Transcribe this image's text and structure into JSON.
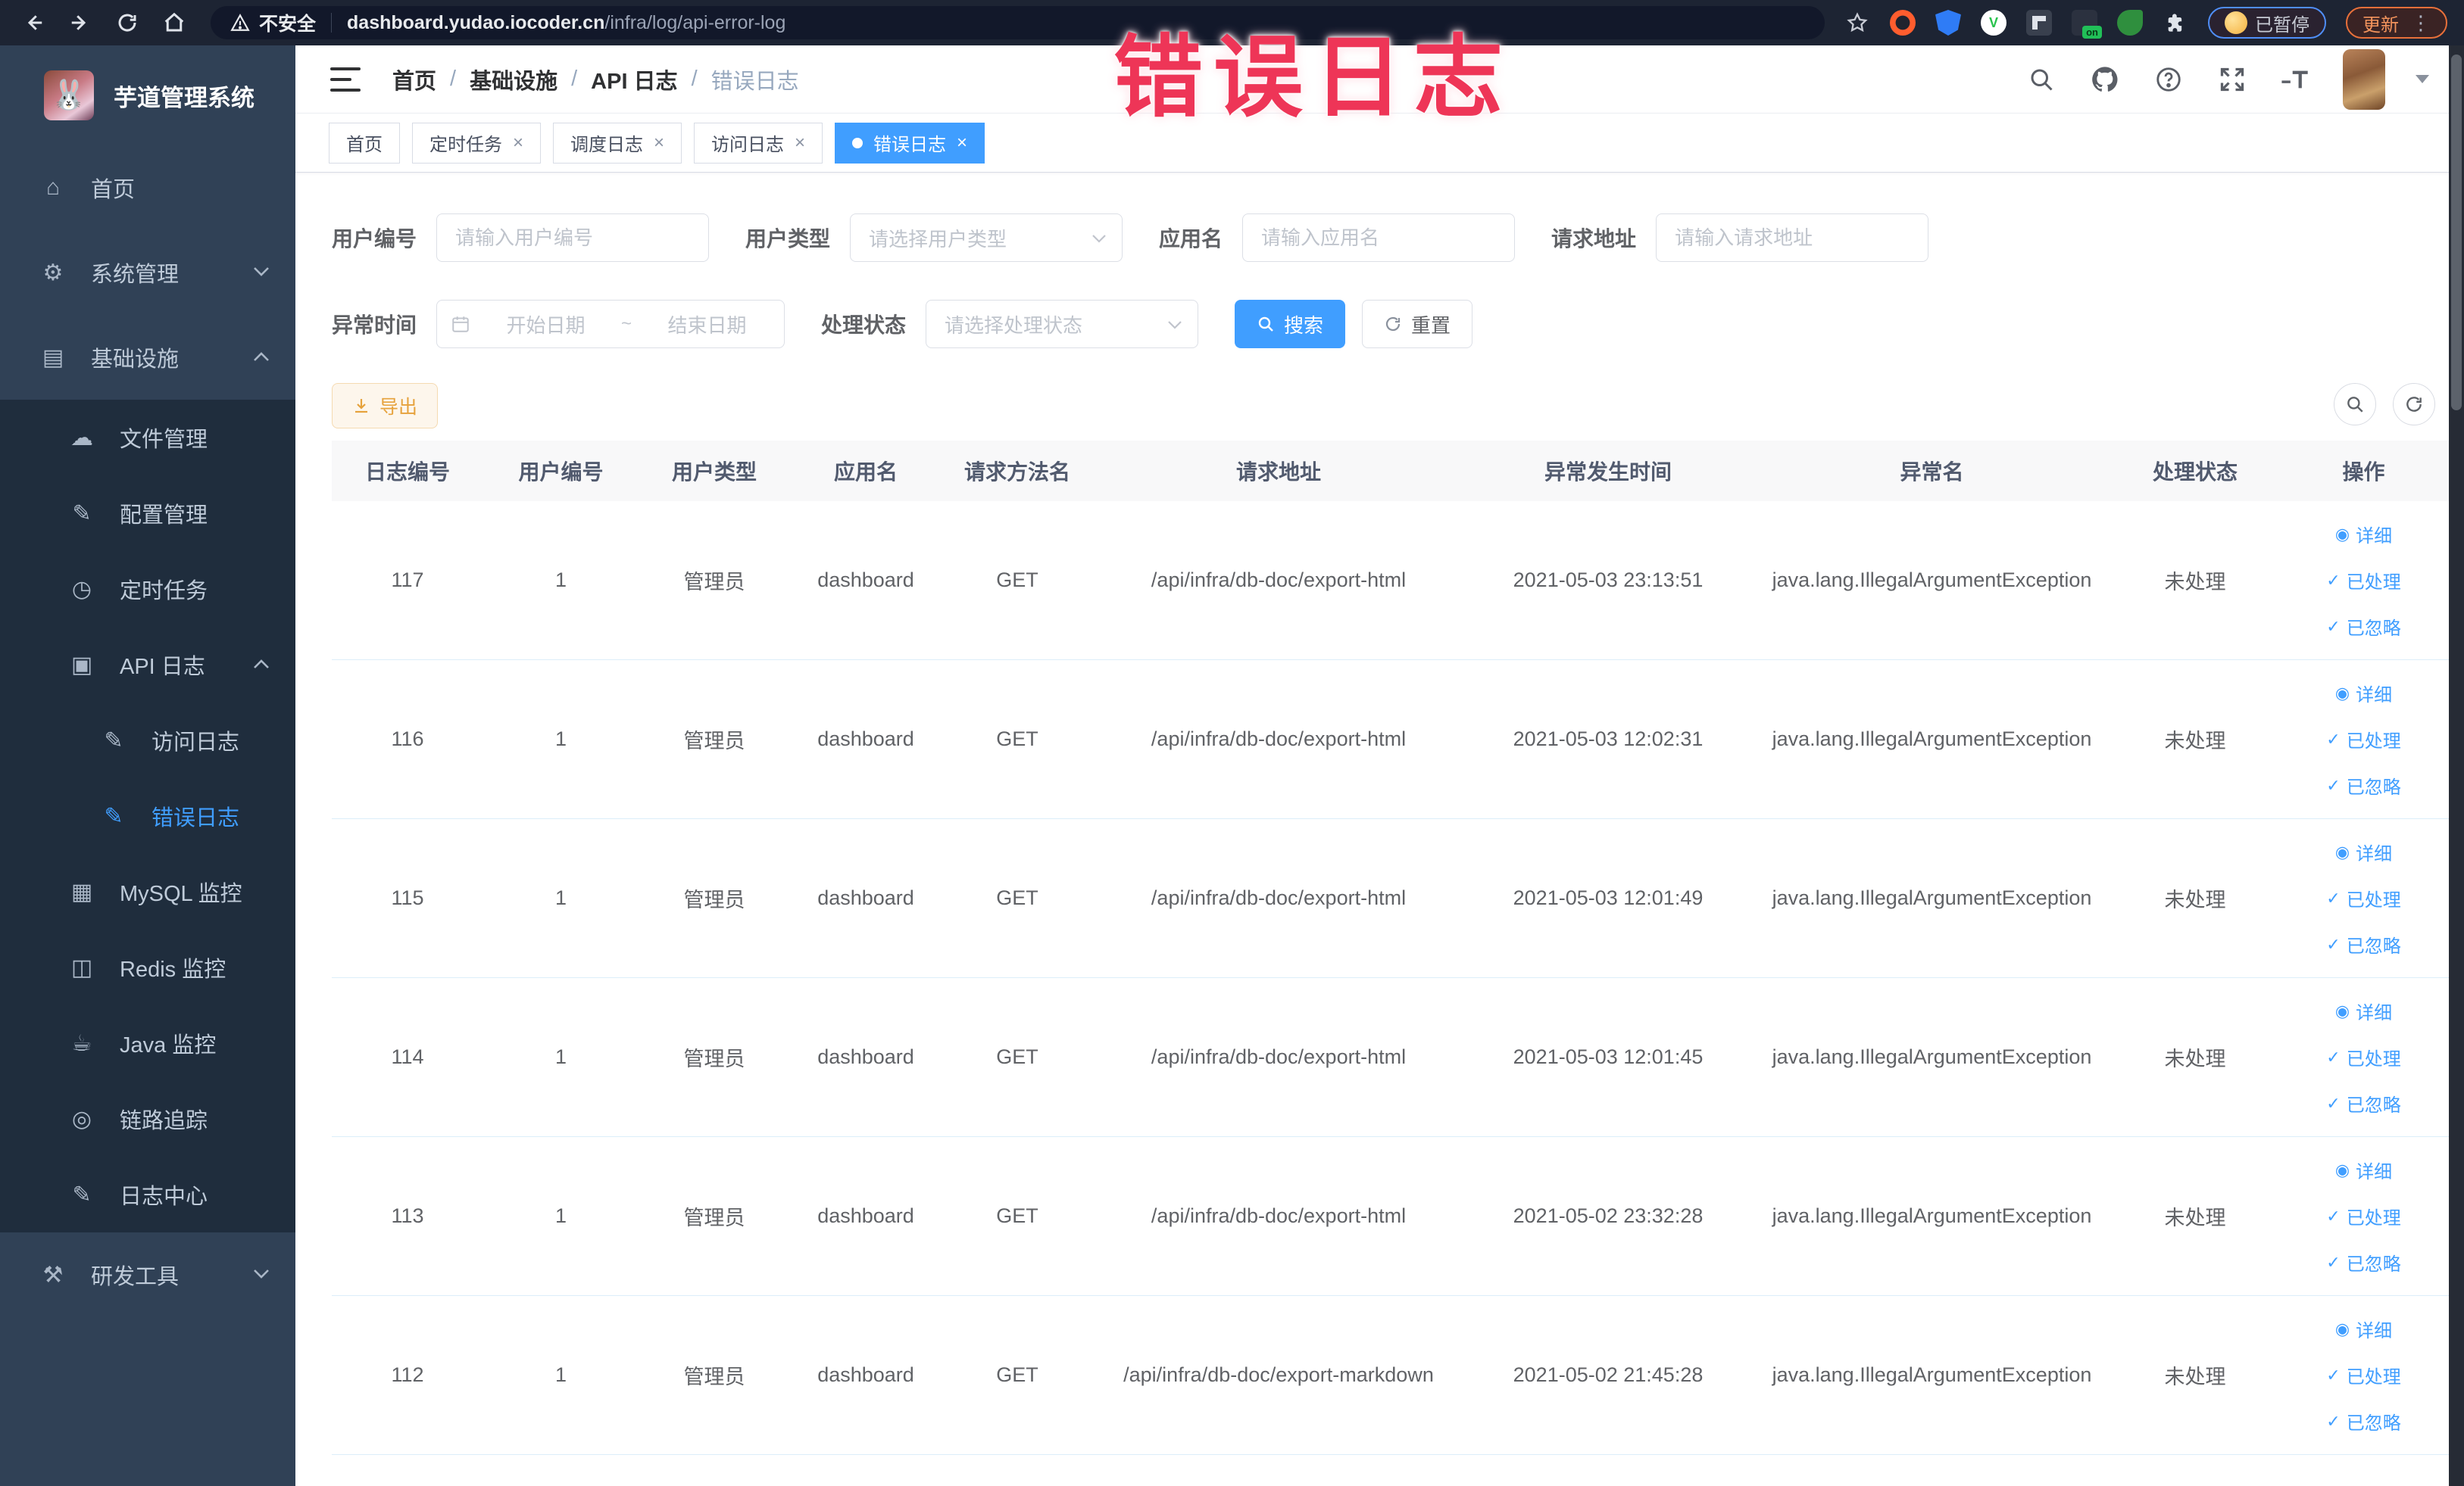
{
  "browser": {
    "security_label": "不安全",
    "url_host": "dashboard.yudao.iocoder.cn",
    "url_path": "/infra/log/api-error-log",
    "profile_chip": "已暂停",
    "update_button": "更新",
    "on_badge": "on"
  },
  "annotation": {
    "text": "错误日志",
    "color": "#ee3557"
  },
  "sidebar": {
    "title": "芋道管理系统",
    "menu": {
      "home": "首页",
      "system": "系统管理",
      "infra": "基础设施",
      "file": "文件管理",
      "config": "配置管理",
      "job": "定时任务",
      "api_log": "API 日志",
      "access_log": "访问日志",
      "error_log": "错误日志",
      "mysql": "MySQL 监控",
      "redis": "Redis 监控",
      "java": "Java 监控",
      "trace": "链路追踪",
      "log_center": "日志中心",
      "dev_tools": "研发工具"
    }
  },
  "header": {
    "breadcrumb": [
      "首页",
      "基础设施",
      "API 日志",
      "错误日志"
    ]
  },
  "tabs": [
    {
      "label": "首页"
    },
    {
      "label": "定时任务"
    },
    {
      "label": "调度日志"
    },
    {
      "label": "访问日志"
    },
    {
      "label": "错误日志"
    }
  ],
  "filters": {
    "user_id": {
      "label": "用户编号",
      "placeholder": "请输入用户编号"
    },
    "user_type": {
      "label": "用户类型",
      "placeholder": "请选择用户类型"
    },
    "app_name": {
      "label": "应用名",
      "placeholder": "请输入应用名"
    },
    "request_url": {
      "label": "请求地址",
      "placeholder": "请输入请求地址"
    },
    "error_time": {
      "label": "异常时间",
      "start_placeholder": "开始日期",
      "separator": "~",
      "end_placeholder": "结束日期"
    },
    "process_status": {
      "label": "处理状态",
      "placeholder": "请选择处理状态"
    },
    "search_label": "搜索",
    "reset_label": "重置"
  },
  "toolbar": {
    "export_label": "导出"
  },
  "table": {
    "columns": [
      "日志编号",
      "用户编号",
      "用户类型",
      "应用名",
      "请求方法名",
      "请求地址",
      "异常发生时间",
      "异常名",
      "处理状态",
      "操作"
    ],
    "row_actions": [
      "详细",
      "已处理",
      "已忽略"
    ],
    "rows": [
      {
        "cells": [
          "117",
          "1",
          "管理员",
          "dashboard",
          "GET",
          "/api/infra/db-doc/export-html",
          "2021-05-03 23:13:51",
          "java.lang.IllegalArgumentException",
          "未处理"
        ]
      },
      {
        "cells": [
          "116",
          "1",
          "管理员",
          "dashboard",
          "GET",
          "/api/infra/db-doc/export-html",
          "2021-05-03 12:02:31",
          "java.lang.IllegalArgumentException",
          "未处理"
        ]
      },
      {
        "cells": [
          "115",
          "1",
          "管理员",
          "dashboard",
          "GET",
          "/api/infra/db-doc/export-html",
          "2021-05-03 12:01:49",
          "java.lang.IllegalArgumentException",
          "未处理"
        ]
      },
      {
        "cells": [
          "114",
          "1",
          "管理员",
          "dashboard",
          "GET",
          "/api/infra/db-doc/export-html",
          "2021-05-03 12:01:45",
          "java.lang.IllegalArgumentException",
          "未处理"
        ]
      },
      {
        "cells": [
          "113",
          "1",
          "管理员",
          "dashboard",
          "GET",
          "/api/infra/db-doc/export-html",
          "2021-05-02 23:32:28",
          "java.lang.IllegalArgumentException",
          "未处理"
        ]
      },
      {
        "cells": [
          "112",
          "1",
          "管理员",
          "dashboard",
          "GET",
          "/api/infra/db-doc/export-markdown",
          "2021-05-02 21:45:28",
          "java.lang.IllegalArgumentException",
          "未处理"
        ]
      }
    ]
  }
}
